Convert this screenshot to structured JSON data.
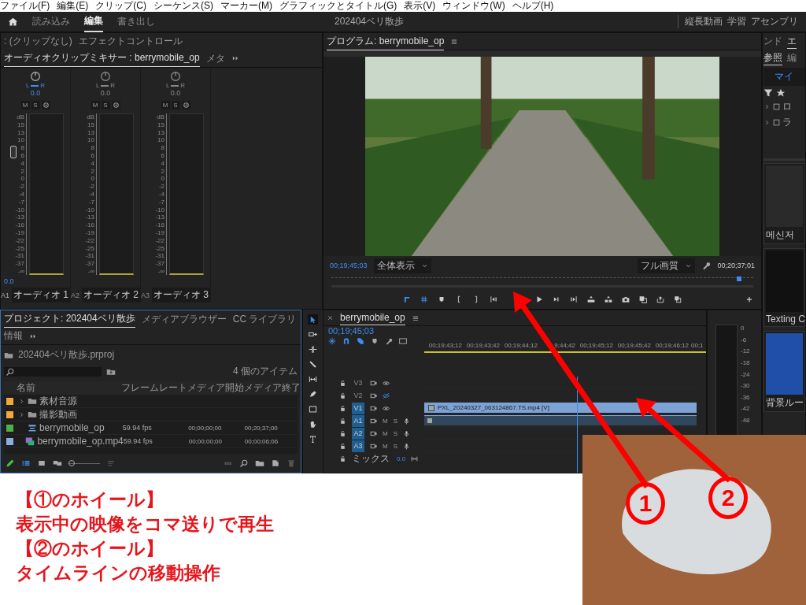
{
  "menu_bar": [
    "ファイル(F)",
    "編集(E)",
    "クリップ(C)",
    "シーケンス(S)",
    "マーカー(M)",
    "グラフィックとタイトル(G)",
    "表示(V)",
    "ウィンドウ(W)",
    "ヘルプ(H)"
  ],
  "header": {
    "workspaces": [
      {
        "label": "読み込み",
        "selected": false
      },
      {
        "label": "編集",
        "selected": true
      },
      {
        "label": "書き出し",
        "selected": false
      }
    ],
    "project_title": "202404ベリ散歩",
    "workspace_tabs": [
      "縦長動画",
      "学習",
      "アセンブリ"
    ]
  },
  "mixer_panel": {
    "tabs": [
      {
        "label": ": (クリップなし)",
        "selected": false
      },
      {
        "label": "エフェクトコントロール",
        "selected": false
      },
      {
        "label": "オーディオクリップミキサー : berrymobile_op",
        "selected": true
      },
      {
        "label": "メタ",
        "selected": false
      }
    ],
    "channels": [
      {
        "active": true,
        "pan_labels": [
          "L",
          "R"
        ],
        "pan": "0.0",
        "buttons": [
          "M",
          "S"
        ],
        "scale": [
          "dB",
          "15",
          "13",
          "10",
          "8",
          "6",
          "4",
          "2",
          "0",
          "-2",
          "-4",
          "-7",
          "-10",
          "-13",
          "-16",
          "-19",
          "-22",
          "-25",
          "-31",
          "-37",
          "-∞"
        ],
        "level": 0.76,
        "reading": "0.0",
        "track": "A1",
        "name": "オーディオ 1"
      },
      {
        "active": false,
        "pan_labels": [
          "L",
          "R"
        ],
        "pan": "0.0",
        "buttons": [
          "M",
          "S"
        ],
        "scale": [
          "dB",
          "15",
          "13",
          "10",
          "8",
          "6",
          "4",
          "2",
          "0",
          "-2",
          "-4",
          "-7",
          "-10",
          "-13",
          "-16",
          "-19",
          "-22",
          "-25",
          "-31",
          "-37",
          "-∞"
        ],
        "track": "A2",
        "name": "オーディオ 2"
      },
      {
        "active": false,
        "pan_labels": [
          "L",
          "R"
        ],
        "pan": "0.0",
        "buttons": [
          "M",
          "S"
        ],
        "scale": [
          "dB",
          "15",
          "13",
          "10",
          "8",
          "6",
          "4",
          "2",
          "0",
          "-2",
          "-4",
          "-7",
          "-10",
          "-13",
          "-16",
          "-19",
          "-22",
          "-25",
          "-31",
          "-37",
          "-∞"
        ],
        "track": "A3",
        "name": "オーディオ 3"
      }
    ]
  },
  "project_panel": {
    "tabs": [
      {
        "label": "プロジェクト: 202404ベリ散歩",
        "selected": true
      },
      {
        "label": "メディアブラウザー",
        "selected": false
      },
      {
        "label": "CC ライブラリ",
        "selected": false
      },
      {
        "label": "情報",
        "selected": false
      }
    ],
    "file": "202404ベリ散歩.prproj",
    "item_count": "4 個のアイテム",
    "columns": [
      "名前",
      "フレームレート",
      "メディア開始",
      "メディア終了"
    ],
    "rows": [
      {
        "kind": "folder",
        "color": "#f0a838",
        "name": "素材音源"
      },
      {
        "kind": "folder",
        "color": "#f0a838",
        "name": "撮影動画"
      },
      {
        "kind": "sequence",
        "color": "#4db04a",
        "name": "berrymobile_op",
        "frame_rate": "59.94 fps",
        "start": "00;00;00;00",
        "end": "00;20;37;00"
      },
      {
        "kind": "clip",
        "color": "#8aaede",
        "name": "berrymobile_op.mp4",
        "frame_rate": "59.94 fps",
        "start": "00;00;00;00",
        "end": "00;00;06;06"
      }
    ],
    "view_buttons": [
      {
        "kind": "list",
        "selected": true
      },
      {
        "kind": "icon",
        "selected": false
      },
      {
        "kind": "freeform",
        "selected": false
      }
    ],
    "zoom_slider": {
      "level": 0
    }
  },
  "tools": [
    {
      "kind": "select",
      "selected": true
    },
    {
      "kind": "track",
      "selected": false
    },
    {
      "kind": "ripple",
      "selected": false
    },
    {
      "kind": "razor",
      "selected": false
    },
    {
      "kind": "slip",
      "selected": false
    },
    {
      "kind": "pen",
      "selected": false
    },
    {
      "kind": "rect",
      "selected": false
    },
    {
      "kind": "hand",
      "selected": false
    },
    {
      "kind": "type",
      "selected": false
    }
  ],
  "program_monitor": {
    "title": "プログラム: berrymobile_op",
    "timecode": "00;19;45;03",
    "fit": "全体表示",
    "quality": "フル画質",
    "duration": "00;20;37;01",
    "playhead": {
      "level": 0.96
    },
    "transport": [
      {
        "kind": "corner",
        "on": true
      },
      {
        "kind": "grid",
        "on": true
      },
      {
        "kind": "marker",
        "on": false
      },
      {
        "kind": "in",
        "on": false
      },
      {
        "kind": "out",
        "on": false
      },
      {
        "kind": "gotoin",
        "on": false
      },
      {
        "kind": "play",
        "on": false
      },
      {
        "kind": "stepfwd",
        "on": false
      },
      {
        "kind": "gotoout",
        "on": false
      },
      {
        "kind": "lift",
        "on": false
      },
      {
        "kind": "extract",
        "on": false
      },
      {
        "kind": "camera",
        "on": false
      },
      {
        "kind": "compare",
        "on": false
      },
      {
        "kind": "export",
        "on": false
      },
      {
        "kind": "overlay",
        "on": false
      }
    ]
  },
  "timeline": {
    "title": "berrymobile_op",
    "timecode": "00;19;45;03",
    "tools": [
      {
        "kind": "nest",
        "on": true
      },
      {
        "kind": "snap",
        "on": true
      },
      {
        "kind": "linked",
        "on": true
      },
      {
        "kind": "marker",
        "on": false
      },
      {
        "kind": "wrench",
        "on": false
      },
      {
        "kind": "captions",
        "on": false
      }
    ],
    "ruler": [
      "00;19;43;12",
      "00;19;43;42",
      "00;19;44;12",
      "9;44;42",
      "00;19;45;12",
      "00;19;45;42",
      "00;19;46;12",
      "00;1"
    ],
    "playhead": {
      "level": 0.56
    },
    "tracks": [
      {
        "kind": "video",
        "name": "V3",
        "targeted": false,
        "visible": true
      },
      {
        "kind": "video",
        "name": "V2",
        "targeted": false,
        "visible": false
      },
      {
        "kind": "video",
        "name": "V1",
        "targeted": true,
        "visible": true,
        "clip": "PXL_20240327_063124867.TS.mp4 [V]"
      },
      {
        "kind": "audio",
        "name": "A1",
        "targeted": true,
        "buttons": [
          "M",
          "S"
        ],
        "waveform": true
      },
      {
        "kind": "audio",
        "name": "A2",
        "targeted": true,
        "buttons": [
          "M",
          "S"
        ],
        "waveform": false
      },
      {
        "kind": "audio",
        "name": "A3",
        "targeted": true,
        "buttons": [
          "M",
          "S"
        ],
        "waveform": false
      },
      {
        "kind": "mix",
        "name": "ミックス",
        "value": "0.0"
      }
    ]
  },
  "audio_meter": {
    "scale": [
      "0",
      "-6",
      "-12",
      "-18",
      "-24",
      "-30",
      "-36",
      "-42",
      "-48"
    ]
  },
  "right_panel": {
    "tabs": [
      {
        "label": "ンド",
        "selected": false
      },
      {
        "label": "エ",
        "selected": true
      }
    ],
    "subtabs": [
      {
        "label": "参照",
        "selected": true
      },
      {
        "label": "編",
        "selected": false
      }
    ],
    "button": "マイ",
    "items": [
      {
        "label": "ロ",
        "checked": false
      },
      {
        "label": "ラ",
        "checked": false
      }
    ],
    "cards": [
      "메신저",
      "Texting C",
      "背景ルー"
    ]
  },
  "annotation": {
    "lines": [
      "【①のホイール】",
      "表示中の映像をコマ送りで再生",
      "【②のホイール】",
      "タイムラインの移動操作"
    ],
    "markers": [
      "1",
      "2"
    ]
  }
}
